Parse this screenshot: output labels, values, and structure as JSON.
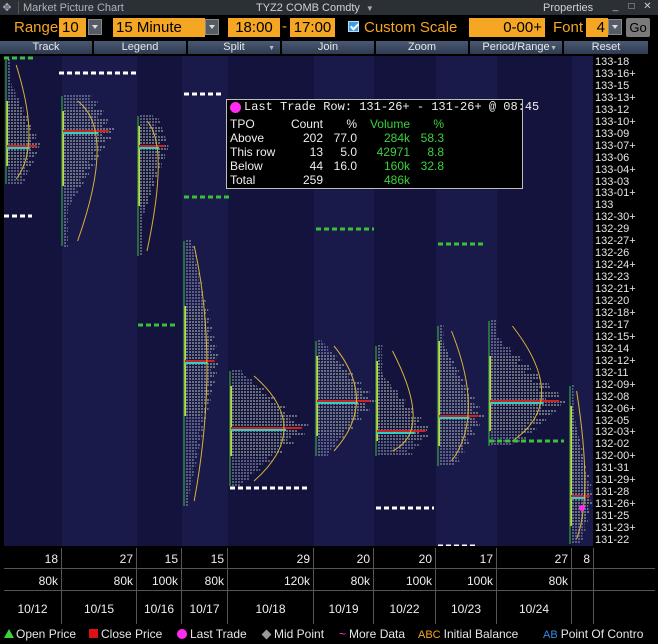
{
  "title_bar": {
    "app_name": "Market Picture Chart",
    "ticker": "TYZ2 COMB Comdty",
    "properties": "Properties",
    "window_buttons": [
      "minimize",
      "maximize",
      "close"
    ]
  },
  "toolbar": {
    "range_label": "Range",
    "range_value": "10",
    "interval_value": "15 Minute",
    "start_time": "18:00",
    "end_time": "17:00",
    "custom_scale_label": "Custom Scale",
    "custom_scale_checked": true,
    "price_field": "0-00+",
    "font_label": "Font",
    "font_value": "4",
    "go_label": "Go"
  },
  "menu": [
    "Track",
    "Legend",
    "Split",
    "Join",
    "Zoom",
    "Period/Range",
    "Reset"
  ],
  "y_axis_labels": [
    "133-18",
    "133-16+",
    "133-15",
    "133-13+",
    "133-12",
    "133-10+",
    "133-09",
    "133-07+",
    "133-06",
    "133-04+",
    "133-03",
    "133-01+",
    "133",
    "132-30+",
    "132-29",
    "132-27+",
    "132-26",
    "132-24+",
    "132-23",
    "132-21+",
    "132-20",
    "132-18+",
    "132-17",
    "132-15+",
    "132-14",
    "132-12+",
    "132-11",
    "132-09+",
    "132-08",
    "132-06+",
    "132-05",
    "132-03+",
    "132-02",
    "132-00+",
    "131-31",
    "131-29+",
    "131-28",
    "131-26+",
    "131-25",
    "131-23+",
    "131-22"
  ],
  "popup": {
    "title": "Last Trade Row:  131-26+ - 131-26+ @  08:45",
    "headers": [
      "TPO",
      "Count",
      "%",
      "Volume",
      "%"
    ],
    "rows": [
      {
        "label": "Above",
        "count": "202",
        "pct": "77.0",
        "volume": "284k",
        "vpct": "58.3"
      },
      {
        "label": "This row",
        "count": "13",
        "pct": "5.0",
        "volume": "42971",
        "vpct": "8.8"
      },
      {
        "label": "Below",
        "count": "44",
        "pct": "16.0",
        "volume": "160k",
        "vpct": "32.8"
      },
      {
        "label": "Total",
        "count": "259",
        "pct": "",
        "volume": "486k",
        "vpct": ""
      }
    ]
  },
  "sessions": [
    {
      "tpo": "18",
      "volume": "80k",
      "date": "10/12"
    },
    {
      "tpo": "27",
      "volume": "80k",
      "date": "10/15"
    },
    {
      "tpo": "15",
      "volume": "100k",
      "date": "10/16"
    },
    {
      "tpo": "15",
      "volume": "80k",
      "date": "10/17"
    },
    {
      "tpo": "29",
      "volume": "120k",
      "date": "10/18"
    },
    {
      "tpo": "20",
      "volume": "80k",
      "date": "10/19"
    },
    {
      "tpo": "20",
      "volume": "100k",
      "date": "10/22"
    },
    {
      "tpo": "17",
      "volume": "100k",
      "date": "10/23"
    },
    {
      "tpo": "27",
      "volume": "80k",
      "date": "10/24"
    },
    {
      "tpo": "8",
      "volume": "",
      "date": ""
    }
  ],
  "legend": {
    "open_price": "Open Price",
    "close_price": "Close Price",
    "last_trade": "Last Trade",
    "mid_point": "Mid Point",
    "more_data": "More Data",
    "abc": "ABC",
    "initial_balance": "Initial Balance",
    "ab": "AB",
    "point_of_control": "Point Of Contro"
  },
  "colors": {
    "chart_bg": "#13133d",
    "accent_orange": "#f5a623",
    "value_green": "#3cd13c",
    "poc_red": "#cc2222",
    "last_trade_magenta": "#ff2bf0"
  }
}
